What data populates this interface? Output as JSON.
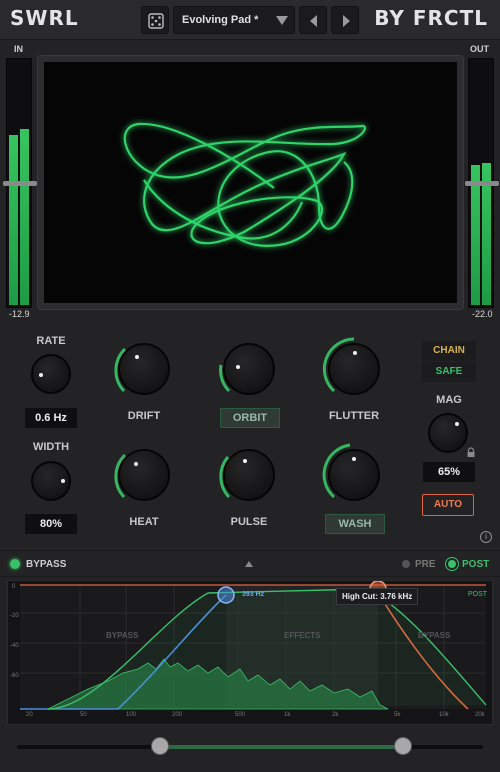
{
  "header": {
    "brand_left": "SWRL",
    "brand_right": "BY FRCTL",
    "preset_name": "Evolving Pad *"
  },
  "meters": {
    "in_label": "IN",
    "out_label": "OUT",
    "in_value": "-12.9",
    "out_value": "-22.0"
  },
  "controls": {
    "rate": {
      "label": "RATE",
      "value": "0.6 Hz"
    },
    "width": {
      "label": "WIDTH",
      "value": "80%"
    },
    "drift": {
      "label": "DRIFT"
    },
    "orbit": {
      "label": "ORBIT"
    },
    "flutter": {
      "label": "FLUTTER"
    },
    "heat": {
      "label": "HEAT"
    },
    "pulse": {
      "label": "PULSE"
    },
    "wash": {
      "label": "WASH"
    },
    "mag": {
      "label": "MAG",
      "value": "65%"
    },
    "chain_label": "CHAIN",
    "safe_label": "SAFE",
    "auto_label": "AUTO",
    "info_label": "i"
  },
  "bypass_bar": {
    "bypass_label": "BYPASS",
    "pre_label": "PRE",
    "post_label": "POST"
  },
  "eq": {
    "low_cut_label": "393 Hz",
    "high_cut_label": "High Cut: 3.76 kHz",
    "post_label": "POST",
    "regions": [
      "BYPASS",
      "EFFECTS",
      "BYPASS"
    ],
    "db_ticks": [
      "0",
      "-20",
      "-40",
      "-60"
    ],
    "freq_ticks": [
      "20",
      "50",
      "100",
      "200",
      "500",
      "1k",
      "2k",
      "5k",
      "10k",
      "20k"
    ]
  },
  "colors": {
    "accent_green": "#3ac06a",
    "scope_green": "#2fd46a",
    "low_cut_blue": "#4a8de0",
    "high_cut_red": "#e0643e",
    "chain_gold": "#d6b34a",
    "auto_orange": "#ee7b52"
  }
}
